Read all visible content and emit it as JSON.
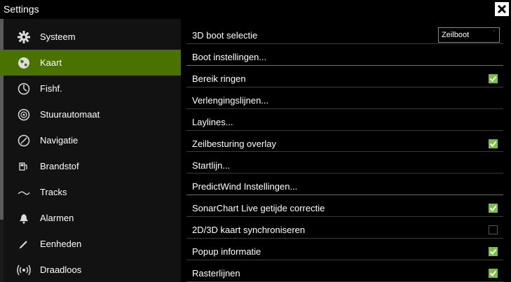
{
  "window": {
    "title": "Settings"
  },
  "sidebar": {
    "items": [
      {
        "label": "Systeem",
        "icon": "gear-icon",
        "selected": false
      },
      {
        "label": "Kaart",
        "icon": "globe-icon",
        "selected": true
      },
      {
        "label": "Fishf.",
        "icon": "fishfinder-icon",
        "selected": false
      },
      {
        "label": "Stuurautomaat",
        "icon": "autopilot-icon",
        "selected": false
      },
      {
        "label": "Navigatie",
        "icon": "compass-icon",
        "selected": false
      },
      {
        "label": "Brandstof",
        "icon": "fuel-icon",
        "selected": false
      },
      {
        "label": "Tracks",
        "icon": "track-icon",
        "selected": false
      },
      {
        "label": "Alarmen",
        "icon": "bell-icon",
        "selected": false
      },
      {
        "label": "Eenheden",
        "icon": "pencil-icon",
        "selected": false
      },
      {
        "label": "Draadloos",
        "icon": "wireless-icon",
        "selected": false
      }
    ]
  },
  "settings": {
    "rows": [
      {
        "label": "3D boot selectie",
        "control": "select",
        "value": "Zeilboot"
      },
      {
        "label": "Boot instellingen...",
        "control": "none"
      },
      {
        "label": "Bereik ringen",
        "control": "checkbox",
        "checked": true
      },
      {
        "label": "Verlengingslijnen...",
        "control": "none"
      },
      {
        "label": "Laylines...",
        "control": "none"
      },
      {
        "label": "Zeilbesturing overlay",
        "control": "checkbox",
        "checked": true
      },
      {
        "label": "Startlijn...",
        "control": "none"
      },
      {
        "label": "PredictWind Instellingen...",
        "control": "none"
      },
      {
        "label": "SonarChart Live getijde correctie",
        "control": "checkbox",
        "checked": true
      },
      {
        "label": "2D/3D kaart synchroniseren",
        "control": "checkbox",
        "checked": false
      },
      {
        "label": "Popup informatie",
        "control": "checkbox",
        "checked": true
      },
      {
        "label": "Rasterlijnen",
        "control": "checkbox",
        "checked": true
      }
    ]
  },
  "colors": {
    "accent": "#4a7200",
    "check": "#7ac143"
  }
}
